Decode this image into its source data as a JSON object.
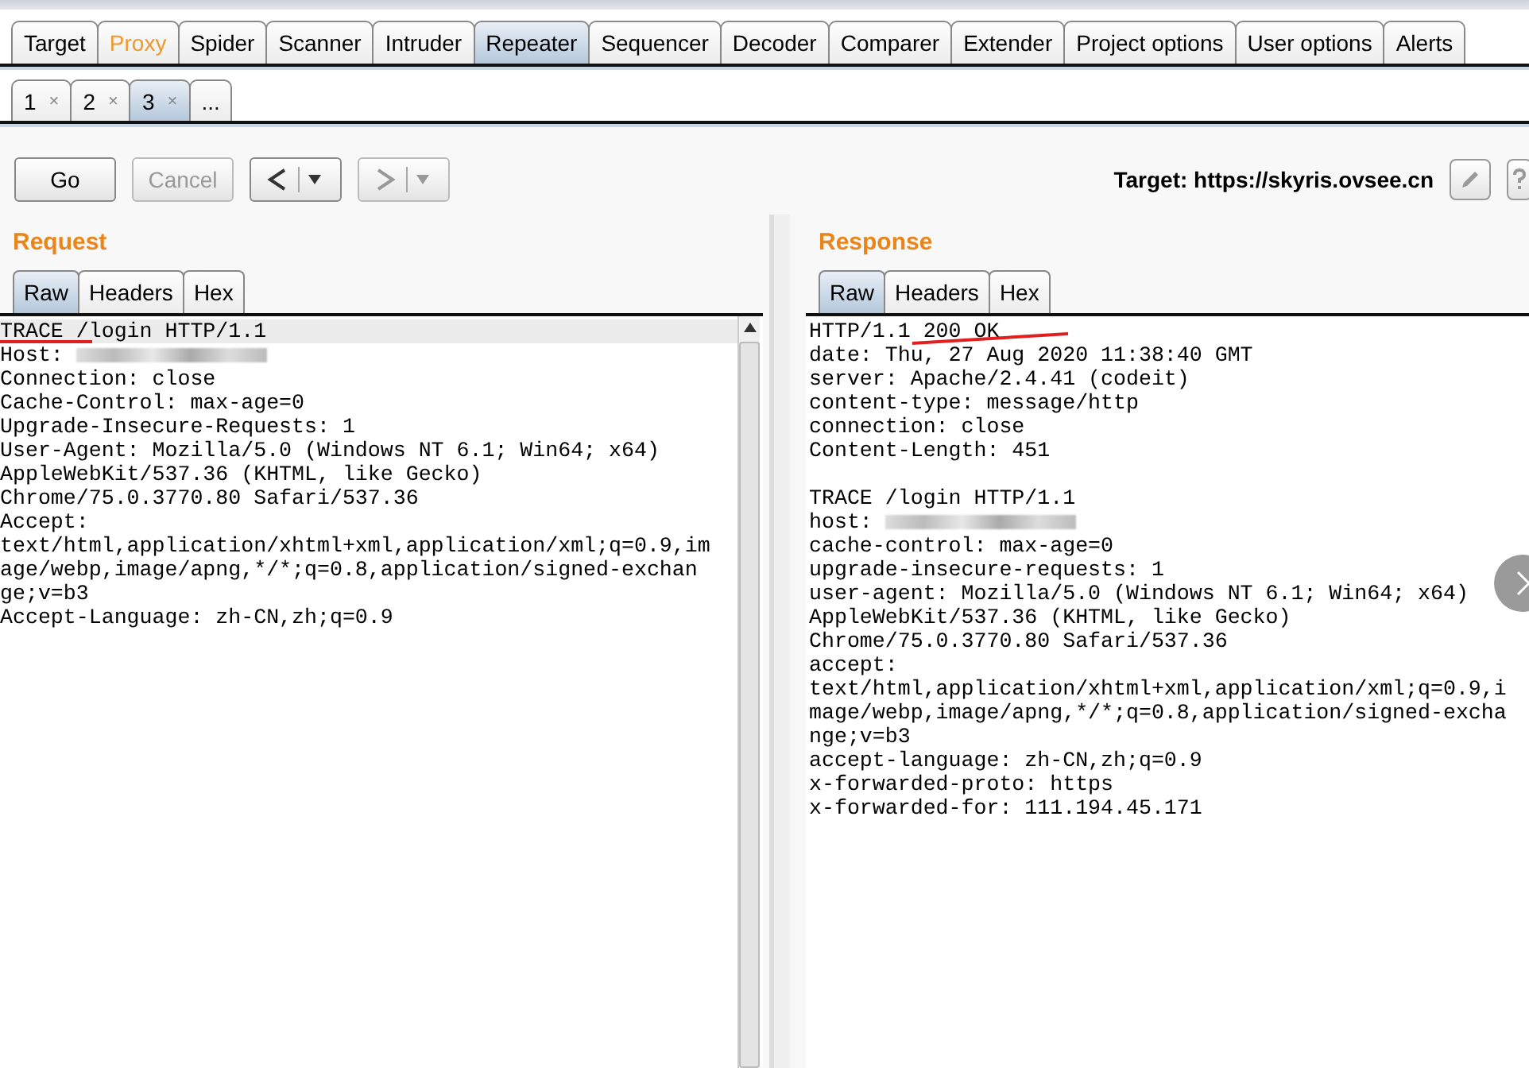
{
  "main_tabs": [
    {
      "label": "Target",
      "selected": false,
      "highlighted": false
    },
    {
      "label": "Proxy",
      "selected": false,
      "highlighted": true
    },
    {
      "label": "Spider",
      "selected": false,
      "highlighted": false
    },
    {
      "label": "Scanner",
      "selected": false,
      "highlighted": false
    },
    {
      "label": "Intruder",
      "selected": false,
      "highlighted": false
    },
    {
      "label": "Repeater",
      "selected": true,
      "highlighted": false
    },
    {
      "label": "Sequencer",
      "selected": false,
      "highlighted": false
    },
    {
      "label": "Decoder",
      "selected": false,
      "highlighted": false
    },
    {
      "label": "Comparer",
      "selected": false,
      "highlighted": false
    },
    {
      "label": "Extender",
      "selected": false,
      "highlighted": false
    },
    {
      "label": "Project options",
      "selected": false,
      "highlighted": false
    },
    {
      "label": "User options",
      "selected": false,
      "highlighted": false
    },
    {
      "label": "Alerts",
      "selected": false,
      "highlighted": false
    }
  ],
  "repeater_tabs": [
    {
      "label": "1",
      "close": "×",
      "selected": false
    },
    {
      "label": "2",
      "close": "×",
      "selected": false
    },
    {
      "label": "3",
      "close": "×",
      "selected": true
    },
    {
      "label": "...",
      "selected": false
    }
  ],
  "toolbar": {
    "buttons": [
      {
        "label": "Go",
        "kind": "text",
        "disabled": false
      },
      {
        "label": "Cancel",
        "kind": "text",
        "disabled": true
      },
      {
        "kind": "back",
        "disabled": false
      },
      {
        "kind": "forward",
        "disabled": true
      }
    ],
    "target": "Target: https://skyris.ovsee.cn"
  },
  "panes": [
    {
      "title": "Request",
      "tabs": [
        {
          "label": "Raw",
          "selected": true
        },
        {
          "label": "Headers",
          "selected": false
        },
        {
          "label": "Hex",
          "selected": false
        }
      ],
      "scrollbar": true,
      "lines": [
        {
          "text": "TRACE /login HTTP/1.1",
          "underlined": true,
          "current": true
        },
        {
          "text": "Host: ",
          "redacted": true
        },
        {
          "text": "Connection: close"
        },
        {
          "text": "Cache-Control: max-age=0"
        },
        {
          "text": "Upgrade-Insecure-Requests: 1"
        },
        {
          "text": "User-Agent: Mozilla/5.0 (Windows NT 6.1; Win64; x64)"
        },
        {
          "text": "AppleWebKit/537.36 (KHTML, like Gecko)"
        },
        {
          "text": "Chrome/75.0.3770.80 Safari/537.36"
        },
        {
          "text": "Accept:"
        },
        {
          "text": "text/html,application/xhtml+xml,application/xml;q=0.9,im"
        },
        {
          "text": "age/webp,image/apng,*/*;q=0.8,application/signed-exchan"
        },
        {
          "text": "ge;v=b3"
        },
        {
          "text": "Accept-Language: zh-CN,zh;q=0.9"
        }
      ]
    },
    {
      "title": "Response",
      "tabs": [
        {
          "label": "Raw",
          "selected": true
        },
        {
          "label": "Headers",
          "selected": false
        },
        {
          "label": "Hex",
          "selected": false
        }
      ],
      "scrollbar": false,
      "lines": [
        {
          "text": "HTTP/1.1 200 OK",
          "underlined": true
        },
        {
          "text": "date: Thu, 27 Aug 2020 11:38:40 GMT"
        },
        {
          "text": "server: Apache/2.4.41 (codeit)"
        },
        {
          "text": "content-type: message/http"
        },
        {
          "text": "connection: close"
        },
        {
          "text": "Content-Length: 451"
        },
        {
          "text": "TRACE /login HTTP/1.1",
          "gap_before": true
        },
        {
          "text": "host: ",
          "redacted": true
        },
        {
          "text": "cache-control: max-age=0"
        },
        {
          "text": "upgrade-insecure-requests: 1"
        },
        {
          "text": "user-agent: Mozilla/5.0 (Windows NT 6.1; Win64; x64)"
        },
        {
          "text": "AppleWebKit/537.36 (KHTML, like Gecko)"
        },
        {
          "text": "Chrome/75.0.3770.80 Safari/537.36"
        },
        {
          "text": "accept:"
        },
        {
          "text": "text/html,application/xhtml+xml,application/xml;q=0.9,i"
        },
        {
          "text": "mage/webp,image/apng,*/*;q=0.8,application/signed-excha"
        },
        {
          "text": "nge;v=b3"
        },
        {
          "text": "accept-language: zh-CN,zh;q=0.9"
        },
        {
          "text": "x-forwarded-proto: https"
        },
        {
          "text": "x-forwarded-for: 111.194.45.171"
        }
      ]
    }
  ]
}
